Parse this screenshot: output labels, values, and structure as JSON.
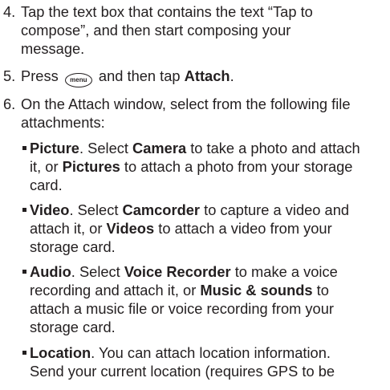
{
  "step4": {
    "number": "4.",
    "line1": "Tap the text box that contains the text “Tap to",
    "line2": "compose”, and then start composing your",
    "line3": "message."
  },
  "step5": {
    "number": "5.",
    "before": "Press",
    "menu_icon_label": "menu",
    "middle": "and then tap",
    "attach": "Attach",
    "end": "."
  },
  "step6": {
    "number": "6.",
    "line1": "On the Attach window, select from the following file",
    "line2": "attachments:"
  },
  "bullets": {
    "picture": {
      "label": "Picture",
      "t1": ". Select",
      "camera": "Camera",
      "t2": "to take a photo and attach",
      "t3": "it, or",
      "pictures": "Pictures",
      "t4": "to attach a photo from your storage",
      "t5": "card."
    },
    "video": {
      "label": "Video",
      "t1": ". Select",
      "camcorder": "Camcorder",
      "t2": "to capture a video and",
      "t3": "attach it, or",
      "videos": "Videos",
      "t4": "to attach a video from your",
      "t5": "storage card."
    },
    "audio": {
      "label": "Audio",
      "t1": ". Select",
      "recorder": "Voice Recorder",
      "t2": "to make a voice",
      "t3": "recording and attach it, or",
      "music": "Music & sounds",
      "t4": "to",
      "t5": "attach a music file or voice recording from your",
      "t6": "storage card."
    },
    "location": {
      "label": "Location",
      "t1": ". You can attach location information.",
      "t2": "Send your current location (requires GPS to be"
    }
  }
}
